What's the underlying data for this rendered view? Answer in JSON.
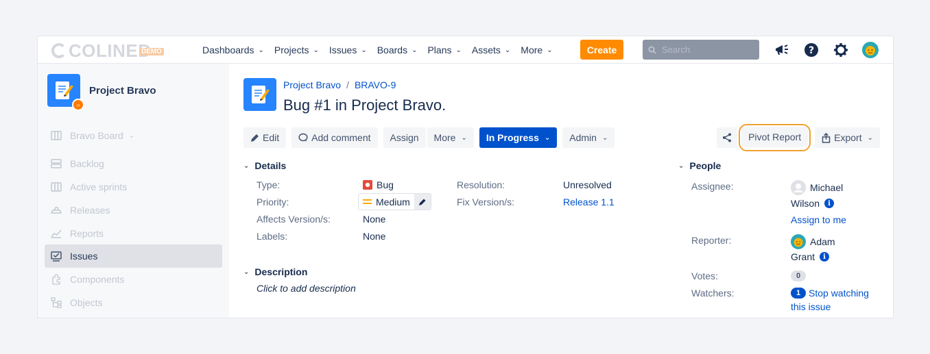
{
  "logo": {
    "text": "COLINED",
    "badge": "DEMO"
  },
  "topnav": {
    "menu": [
      {
        "label": "Dashboards"
      },
      {
        "label": "Projects"
      },
      {
        "label": "Issues"
      },
      {
        "label": "Boards"
      },
      {
        "label": "Plans"
      },
      {
        "label": "Assets"
      },
      {
        "label": "More"
      }
    ],
    "create_label": "Create",
    "search_placeholder": "Search",
    "icons": [
      "megaphone-icon",
      "help-icon",
      "gear-icon",
      "profile-avatar"
    ]
  },
  "sidebar": {
    "project_name": "Project Bravo",
    "board_label": "Bravo Board",
    "items": [
      {
        "label": "Backlog",
        "icon": "backlog-icon"
      },
      {
        "label": "Active sprints",
        "icon": "sprints-icon"
      },
      {
        "label": "Releases",
        "icon": "releases-icon"
      },
      {
        "label": "Reports",
        "icon": "reports-icon"
      },
      {
        "label": "Issues",
        "icon": "issues-icon",
        "active": true
      },
      {
        "label": "Components",
        "icon": "components-icon"
      },
      {
        "label": "Objects",
        "icon": "objects-icon"
      }
    ]
  },
  "issue": {
    "breadcrumb_project": "Project Bravo",
    "breadcrumb_separator": "/",
    "breadcrumb_key": "BRAVO-9",
    "title": "Bug #1 in Project Bravo."
  },
  "toolbar": {
    "edit": "Edit",
    "add_comment": "Add comment",
    "assign": "Assign",
    "more": "More",
    "status": "In Progress",
    "admin": "Admin",
    "pivot_report": "Pivot Report",
    "export": "Export"
  },
  "details": {
    "heading": "Details",
    "type_label": "Type:",
    "type_value": "Bug",
    "priority_label": "Priority:",
    "priority_value": "Medium",
    "affects_label": "Affects Version/s:",
    "affects_value": "None",
    "labels_label": "Labels:",
    "labels_value": "None",
    "resolution_label": "Resolution:",
    "resolution_value": "Unresolved",
    "fix_label": "Fix Version/s:",
    "fix_value": "Release 1.1"
  },
  "description": {
    "heading": "Description",
    "placeholder": "Click to add description"
  },
  "people": {
    "heading": "People",
    "assignee_label": "Assignee:",
    "assignee_first": "Michael",
    "assignee_last": "Wilson",
    "assign_to_me": "Assign to me",
    "reporter_label": "Reporter:",
    "reporter_first": "Adam",
    "reporter_last": "Grant",
    "votes_label": "Votes:",
    "votes_count": "0",
    "watchers_label": "Watchers:",
    "watchers_count": "1",
    "stop_watching_1": "Stop watching",
    "stop_watching_2": "this issue"
  },
  "colors": {
    "brand": "#0052cc",
    "create": "#ff8b00",
    "bug": "#e5493a",
    "medium": "#ffab00",
    "highlight": "#f0a030"
  }
}
